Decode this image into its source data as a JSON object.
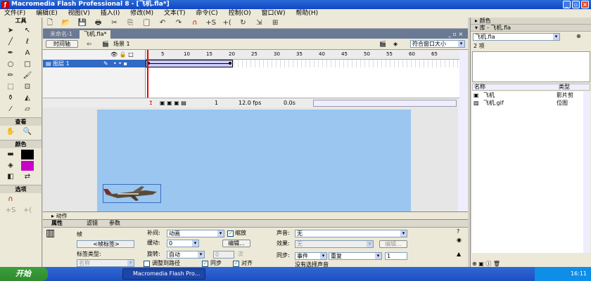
{
  "window": {
    "title": "Macromedia Flash Professional 8 - [飞机.fla*]",
    "min_icon": "minimize-icon",
    "max_icon": "restore-icon",
    "close_icon": "close-icon"
  },
  "menu": [
    "文件(F)",
    "编辑(E)",
    "视图(V)",
    "插入(I)",
    "修改(M)",
    "文本(T)",
    "命令(C)",
    "控制(O)",
    "窗口(W)",
    "帮助(H)"
  ],
  "tools": {
    "header": "工具",
    "view_label": "查看",
    "colors_label": "颜色",
    "options_label": "选项",
    "icons": [
      "arrow-icon",
      "subselect-icon",
      "line-icon",
      "lasso-icon",
      "pen-icon",
      "text-icon",
      "oval-icon",
      "rect-icon",
      "pencil-icon",
      "brush-icon",
      "freetransform-icon",
      "fill-transform-icon",
      "inkbottle-icon",
      "paintbucket-icon",
      "eyedropper-icon",
      "eraser-icon"
    ]
  },
  "doc_tabs": [
    "未命名-1",
    "飞机.fla*"
  ],
  "scene": {
    "timeline_btn": "时间轴",
    "scene_label": "场景 1",
    "zoom": "符合窗口大小"
  },
  "timeline": {
    "layer_name": "图层 1",
    "frame_numbers": [
      "5",
      "10",
      "15",
      "20",
      "25",
      "30",
      "35",
      "40",
      "45",
      "50",
      "55",
      "60",
      "65"
    ],
    "current_frame": "1",
    "fps": "12.0 fps",
    "time": "0.0s"
  },
  "actions_panel": {
    "label": "动作"
  },
  "properties": {
    "tabs": [
      "属性",
      "滤镜",
      "参数"
    ],
    "frame_label": "帧",
    "frame_name_placeholder": "<帧标签>",
    "label_type": "标签类型:",
    "label_type_value": "名称",
    "tween_label": "补间:",
    "tween_value": "动画",
    "scale_label": "缩放",
    "ease_label": "缓动:",
    "ease_value": "0",
    "edit_btn": "编辑...",
    "rotate_label": "旋转:",
    "rotate_value": "自动",
    "rotate_times": "0",
    "rotate_unit": "次",
    "orient_label": "调整到路径",
    "sync_label": "同步",
    "snap_label": "对齐",
    "sound_label": "声音:",
    "sound_value": "无",
    "effect_label": "效果:",
    "effect_value": "无",
    "edit_btn2": "编辑...",
    "sync2_label": "同步:",
    "sync2_value": "事件",
    "repeat_value": "重复",
    "repeat_count": "1",
    "no_sound": "没有选择声音"
  },
  "right_panel": {
    "colors_header": "颜色",
    "library_header": "库 - 飞机.fla",
    "library_select": "飞机.fla",
    "item_count": "2 项",
    "col_name": "名称",
    "col_type": "类型",
    "items": [
      {
        "name": "飞机",
        "type": "影片剪"
      },
      {
        "name": "飞机.gif",
        "type": "位图"
      }
    ]
  },
  "taskbar": {
    "start": "开始",
    "item": "Macromedia Flash Pro...",
    "clock": "16:11"
  }
}
